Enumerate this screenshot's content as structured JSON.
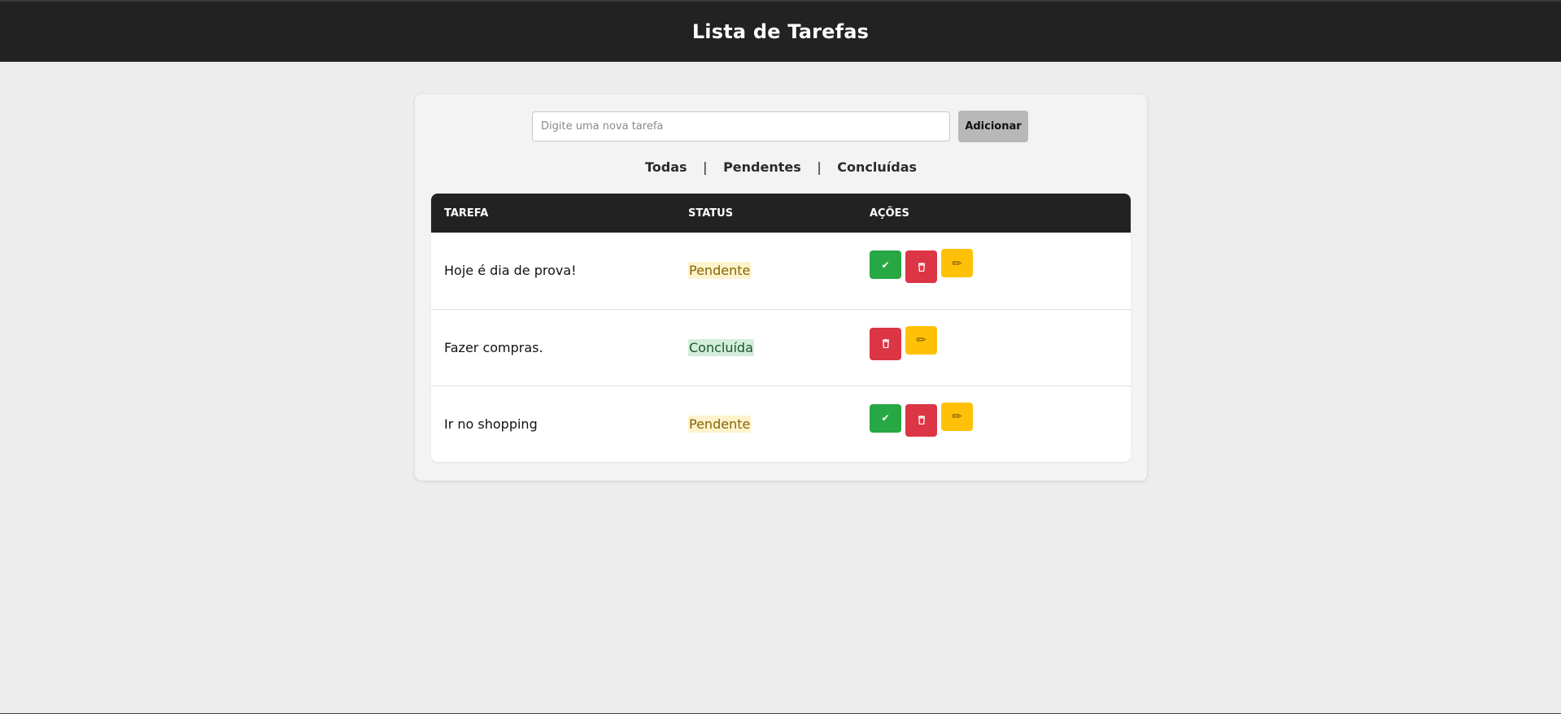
{
  "header": {
    "title": "Lista de Tarefas"
  },
  "add_task": {
    "placeholder": "Digite uma nova tarefa",
    "value": "",
    "button_label": "Adicionar"
  },
  "filters": {
    "all": "Todas",
    "pending": "Pendentes",
    "completed": "Concluídas",
    "separator": "|"
  },
  "table": {
    "headers": {
      "task": "TAREFA",
      "status": "STATUS",
      "actions": "AÇÕES"
    },
    "rows": [
      {
        "task": "Hoje é dia de prova!",
        "status": "Pendente",
        "status_type": "pending",
        "actions": [
          "complete-icon",
          "trash-icon",
          "pencil-icon"
        ]
      },
      {
        "task": "Fazer compras.",
        "status": "Concluída",
        "status_type": "done",
        "actions": [
          "trash-icon",
          "pencil-icon"
        ]
      },
      {
        "task": "Ir no shopping",
        "status": "Pendente",
        "status_type": "pending",
        "actions": [
          "complete-icon",
          "trash-icon",
          "pencil-icon"
        ]
      }
    ]
  },
  "colors": {
    "header_bg": "#222222",
    "page_bg": "#ededed",
    "complete_button": "#28a745",
    "delete_button": "#dc3545",
    "edit_button": "#ffc107",
    "pending_badge_bg": "#fff3cd",
    "pending_badge_text": "#856404",
    "done_badge_bg": "#d4edda",
    "done_badge_text": "#155724",
    "add_button": "#b8b8b8"
  }
}
